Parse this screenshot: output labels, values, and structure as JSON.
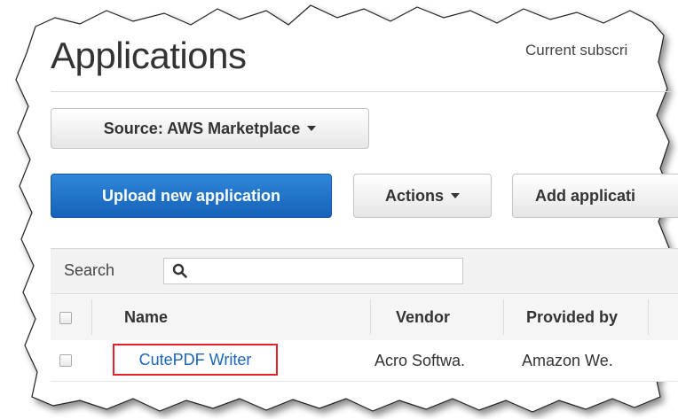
{
  "page": {
    "title": "Applications",
    "subscription_text": "Current subscri"
  },
  "toolbar": {
    "source_label": "Source: AWS Marketplace",
    "upload_label": "Upload new application",
    "actions_label": "Actions",
    "add_label": "Add applicati"
  },
  "search": {
    "label": "Search",
    "value": ""
  },
  "table": {
    "columns": [
      "Name",
      "Vendor",
      "Provided by"
    ],
    "rows": [
      {
        "name": "CutePDF Writer",
        "vendor": "Acro Softwa.",
        "provided_by": "Amazon We."
      }
    ]
  },
  "colors": {
    "primary_button": "#1563b8",
    "link": "#1a66b8",
    "highlight_box": "#e8202a"
  },
  "icons": [
    "search-icon",
    "caret-down-icon"
  ]
}
